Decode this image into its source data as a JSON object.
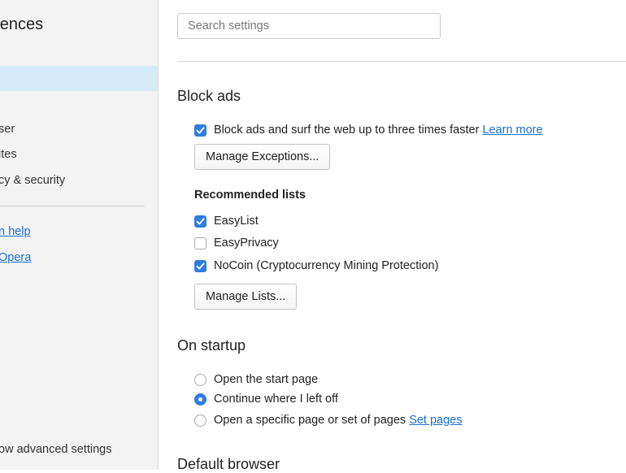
{
  "sidebar": {
    "title": "erences",
    "items": [
      {
        "label": "ser"
      },
      {
        "label": "ites"
      },
      {
        "label": "cy & security"
      }
    ],
    "links": [
      {
        "label": "n help"
      },
      {
        "label": "Opera"
      }
    ],
    "advanced_label": "ow advanced settings"
  },
  "search": {
    "placeholder": "Search settings",
    "value": ""
  },
  "block_ads": {
    "title": "Block ads",
    "enable_label": "Block ads and surf the web up to three times faster",
    "enable_checked": true,
    "learn_more": "Learn more",
    "manage_exceptions": "Manage Exceptions...",
    "recommended_title": "Recommended lists",
    "lists": [
      {
        "label": "EasyList",
        "checked": true
      },
      {
        "label": "EasyPrivacy",
        "checked": false
      },
      {
        "label": "NoCoin (Cryptocurrency Mining Protection)",
        "checked": true
      }
    ],
    "manage_lists": "Manage Lists..."
  },
  "on_startup": {
    "title": "On startup",
    "options": [
      {
        "label": "Open the start page",
        "selected": false
      },
      {
        "label": "Continue where I left off",
        "selected": true
      },
      {
        "label": "Open a specific page or set of pages",
        "selected": false
      }
    ],
    "set_pages": "Set pages"
  },
  "default_browser": {
    "title": "Default browser"
  },
  "colors": {
    "accent": "#2f7de1",
    "link": "#1a6fd1",
    "sidebar_active": "#d5ebf7"
  }
}
